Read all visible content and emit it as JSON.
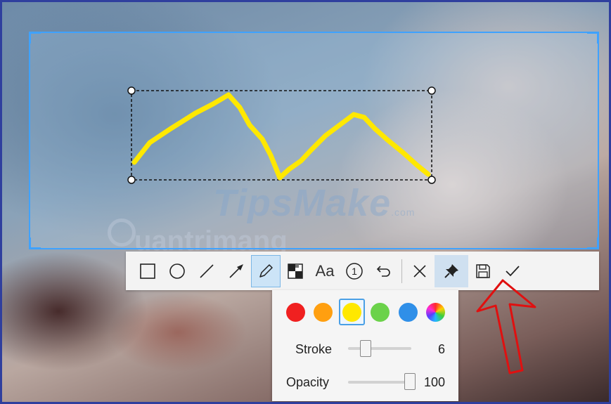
{
  "toolbar": {
    "tools": [
      {
        "name": "rectangle-tool",
        "icon": "rectangle-icon"
      },
      {
        "name": "ellipse-tool",
        "icon": "ellipse-icon"
      },
      {
        "name": "line-tool",
        "icon": "line-icon"
      },
      {
        "name": "arrow-tool",
        "icon": "arrow-icon"
      },
      {
        "name": "pen-tool",
        "icon": "pencil-icon",
        "active": true
      },
      {
        "name": "mosaic-tool",
        "icon": "mosaic-icon"
      },
      {
        "name": "text-tool",
        "icon": "text-icon"
      },
      {
        "name": "number-tool",
        "icon": "number-marker-icon"
      },
      {
        "name": "undo-tool",
        "icon": "undo-icon"
      },
      {
        "name": "cancel-tool",
        "icon": "close-icon"
      },
      {
        "name": "pin-tool",
        "icon": "pin-icon"
      },
      {
        "name": "save-tool",
        "icon": "save-icon"
      },
      {
        "name": "confirm-tool",
        "icon": "check-icon"
      }
    ],
    "text_tool_label": "Aa",
    "number_tool_label": "1"
  },
  "pen_panel": {
    "colors": [
      "#f02020",
      "#ff9f10",
      "#ffe800",
      "#6bd24a",
      "#2f8fe8",
      "rainbow"
    ],
    "selected_color": "#ffe800",
    "stroke": {
      "label": "Stroke",
      "value": "6",
      "fraction": 0.27
    },
    "opacity": {
      "label": "Opacity",
      "value": "100",
      "fraction": 1.0
    }
  },
  "watermarks": {
    "tipsmake": "TipsMake",
    "tipsmake_suffix": ".com",
    "quantrimang": "uantrimang"
  },
  "accent_color": "#3fa2ff",
  "annotation_color": "#ffe800",
  "arrow_color": "#e01010"
}
